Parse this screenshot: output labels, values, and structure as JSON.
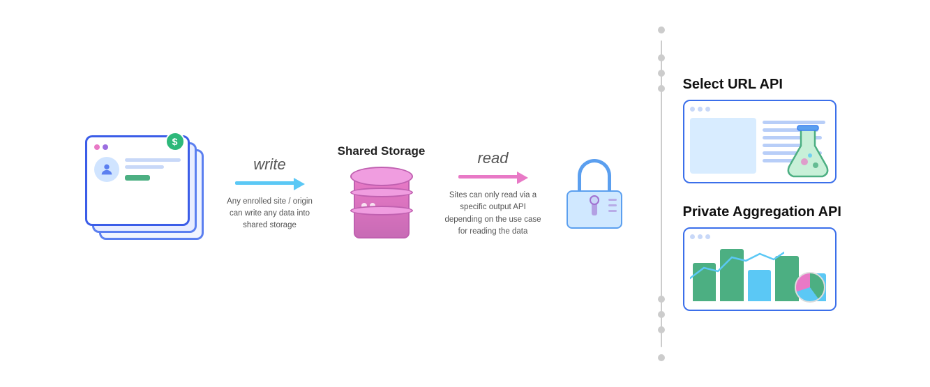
{
  "diagram": {
    "write_label": "write",
    "read_label": "read",
    "storage_title": "Shared Storage",
    "write_desc": "Any enrolled site / origin can write any data into shared storage",
    "read_desc": "Sites can only read via a specific output API depending on the use case for reading the data",
    "api1_title": "Select URL API",
    "api2_title": "Private Aggregation API"
  },
  "colors": {
    "blue_arrow": "#5bc8f5",
    "pink_arrow": "#e879c6",
    "db_color": "#e879c6",
    "border_blue": "#3b6fea"
  }
}
